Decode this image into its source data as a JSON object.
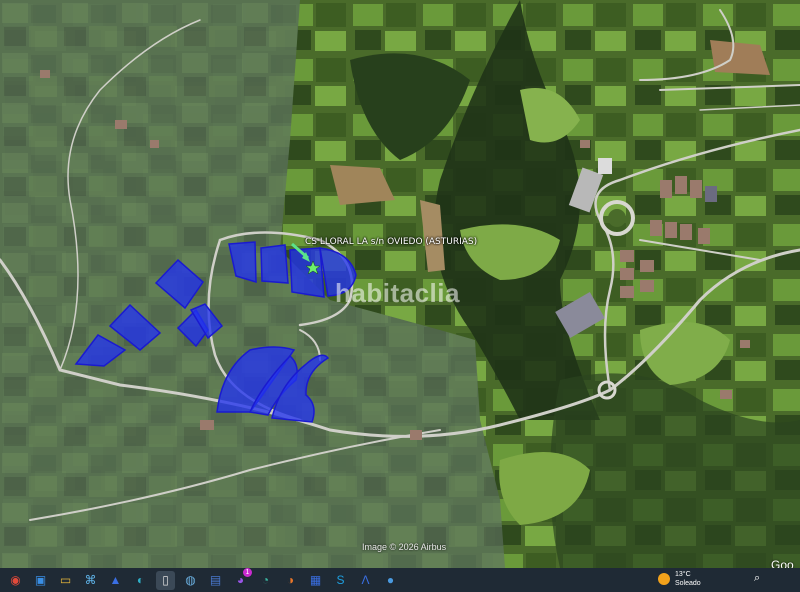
{
  "map": {
    "placemark_label": "CS LLORAL LA s/n OVIEDO (ASTURIAS)",
    "watermark": "habitaclia",
    "imagery_credit": "Image © 2026 Airbus",
    "brand_partial": "Goo",
    "colors": {
      "parcel_fill": "#2233ee",
      "parcel_stroke": "#1a1ad0",
      "pointer": "#5be38a",
      "road": "#cfcfc8"
    }
  },
  "taskbar": {
    "items": [
      {
        "name": "chrome-icon",
        "glyph": "◉"
      },
      {
        "name": "news-icon",
        "glyph": "▣"
      },
      {
        "name": "folder-icon",
        "glyph": "▭"
      },
      {
        "name": "network-icon",
        "glyph": "⌘"
      },
      {
        "name": "photos-icon",
        "glyph": "▲"
      },
      {
        "name": "edge-icon",
        "glyph": "◐"
      },
      {
        "name": "document-icon",
        "glyph": "▯"
      },
      {
        "name": "globe-icon",
        "glyph": "◍"
      },
      {
        "name": "save-icon",
        "glyph": "▤"
      },
      {
        "name": "messenger-icon",
        "glyph": "◕",
        "badge": "1"
      },
      {
        "name": "copilot-icon",
        "glyph": "◔"
      },
      {
        "name": "firefox-icon",
        "glyph": "◑"
      },
      {
        "name": "store-icon",
        "glyph": "▦"
      },
      {
        "name": "s-app-icon",
        "glyph": "S"
      },
      {
        "name": "arrow-app-icon",
        "glyph": "Ʌ"
      },
      {
        "name": "earth-icon",
        "glyph": "●"
      }
    ],
    "weather": {
      "temp": "13°C",
      "condition": "Soleado"
    },
    "search_icon": "search-icon"
  }
}
